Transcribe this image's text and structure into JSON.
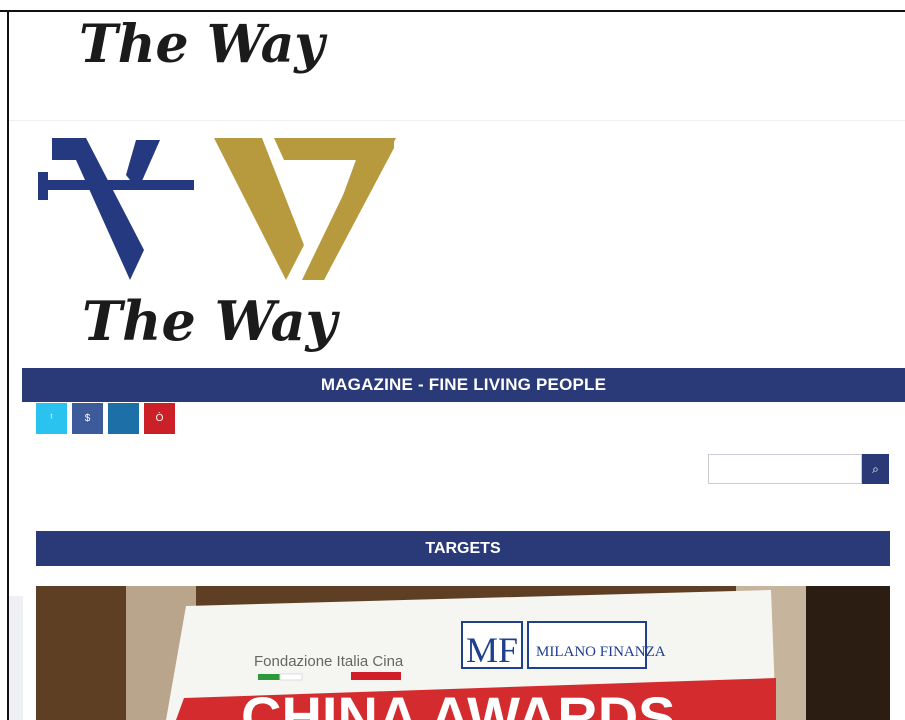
{
  "site": {
    "logo_text": "The Way",
    "logo_letters": [
      "T",
      "W"
    ]
  },
  "nav": {
    "tagline": "MAGAZINE - FINE LIVING PEOPLE"
  },
  "social": [
    {
      "name": "twitter-icon",
      "glyph": "ᵗ"
    },
    {
      "name": "facebook-icon",
      "glyph": "$"
    },
    {
      "name": "linkedin-icon",
      "glyph": ""
    },
    {
      "name": "pinterest-icon",
      "glyph": "Ò"
    }
  ],
  "search": {
    "placeholder": "",
    "value": "",
    "button_glyph": "⌕"
  },
  "section": {
    "title": "TARGETS"
  },
  "featured_image": {
    "sign_lines": [
      "Fondazione Italia Cina",
      "MF",
      "MILANO FINANZA",
      "CHINA AWARDS"
    ]
  },
  "colors": {
    "brand_navy": "#2a3a78",
    "brand_gold": "#b89a3e",
    "twitter": "#2ac3f0",
    "facebook": "#3d5b9a",
    "linkedin": "#1d6fa7",
    "pinterest": "#cb2027"
  }
}
